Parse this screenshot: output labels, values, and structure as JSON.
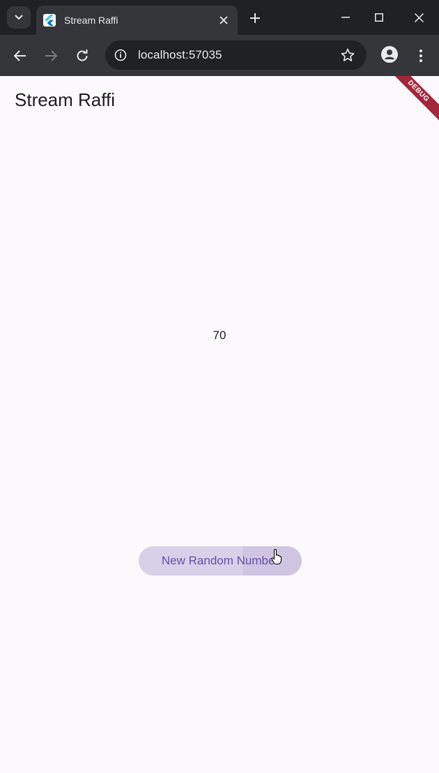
{
  "browser": {
    "tab_title": "Stream Raffi",
    "url": "localhost:57035"
  },
  "app": {
    "title": "Stream Raffi",
    "number": "70",
    "button_label": "New Random Number",
    "debug_banner": "DEBUG"
  },
  "colors": {
    "chrome_dark": "#202124",
    "chrome_toolbar": "#35363a",
    "page_bg": "#fcf9fd",
    "button_bg": "#d8cfe8",
    "button_text": "#6750a4",
    "debug_red": "#a3263b"
  },
  "icons": {
    "tab_search": "chevron-down-icon",
    "tab_favicon": "flutter-icon",
    "tab_close": "close-icon",
    "new_tab": "plus-icon",
    "back": "back-arrow-icon",
    "forward": "forward-arrow-icon",
    "reload": "reload-icon",
    "site_info": "info-icon",
    "bookmark": "star-icon",
    "profile": "profile-icon",
    "menu": "kebab-menu-icon"
  }
}
